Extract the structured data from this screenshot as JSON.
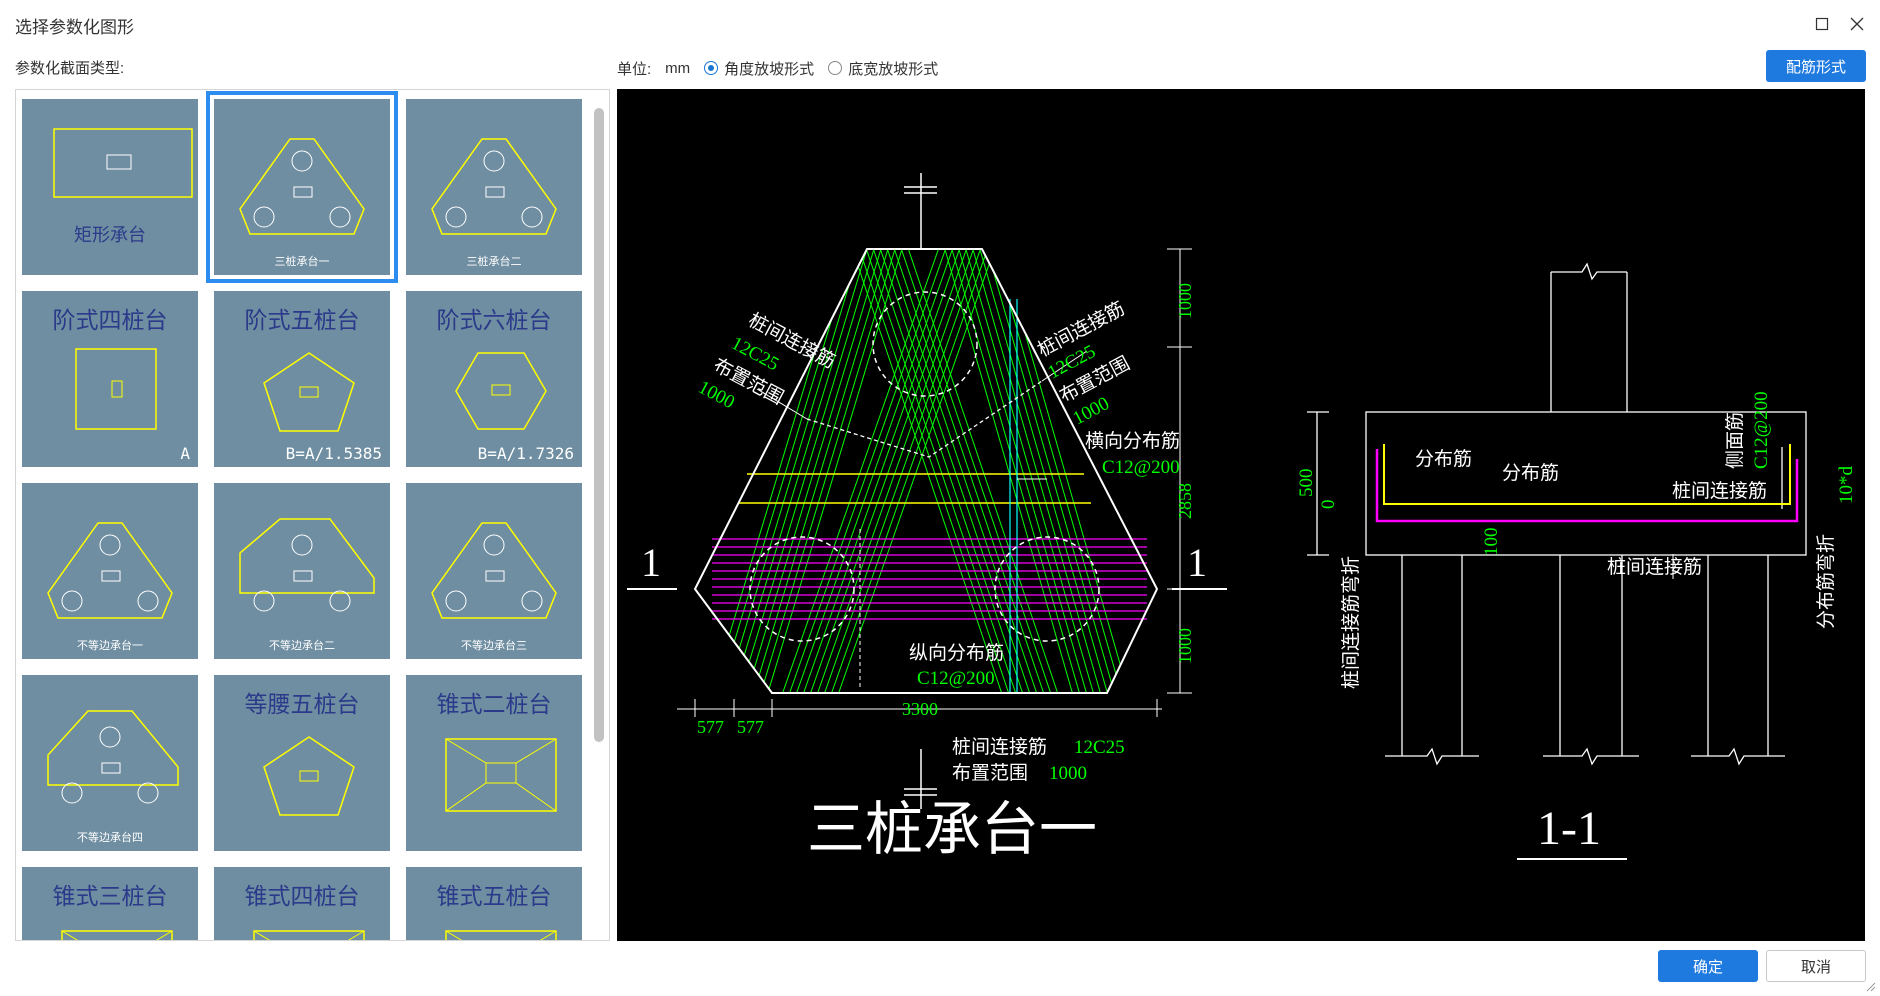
{
  "window": {
    "title": "选择参数化图形"
  },
  "left": {
    "types_label": "参数化截面类型:"
  },
  "top": {
    "unit_label": "单位:",
    "unit_value": "mm",
    "option_angle": "角度放坡形式",
    "option_width": "底宽放坡形式",
    "rebar_button": "配筋形式"
  },
  "footer": {
    "ok": "确定",
    "cancel": "取消"
  },
  "gallery": [
    {
      "name": "矩形承台",
      "style": "bottom"
    },
    {
      "name": "三桩承台一",
      "style": "small",
      "selected": true
    },
    {
      "name": "三桩承台二",
      "style": "small"
    },
    {
      "name": "阶式四桩台",
      "style": "top",
      "note": "A"
    },
    {
      "name": "阶式五桩台",
      "style": "top",
      "note": "B=A/1.5385"
    },
    {
      "name": "阶式六桩台",
      "style": "top",
      "note": "B=A/1.7326"
    },
    {
      "name": "不等边承台一",
      "style": "small"
    },
    {
      "name": "不等边承台二",
      "style": "small"
    },
    {
      "name": "不等边承台三",
      "style": "small"
    },
    {
      "name": "不等边承台四",
      "style": "small"
    },
    {
      "name": "等腰五桩台",
      "style": "top"
    },
    {
      "name": "锥式二桩台",
      "style": "top"
    },
    {
      "name": "锥式三桩台",
      "style": "top"
    },
    {
      "name": "锥式四桩台",
      "style": "top"
    },
    {
      "name": "锥式五桩台",
      "style": "top"
    }
  ],
  "drawing": {
    "plan_title": "三桩承台一",
    "section_title": "1-1",
    "section_mark": "1",
    "labels": {
      "left_conn": "桩间连接筋",
      "left_conn_val": "12C25",
      "left_range": "布置范围",
      "left_range_val": "1000",
      "right_conn": "桩间连接筋",
      "right_conn_val": "12C25",
      "right_range": "布置范围",
      "right_range_val": "1000",
      "trans": "横向分布筋",
      "trans_val": "C12@200",
      "long": "纵向分布筋",
      "long_val": "C12@200",
      "bot_conn": "桩间连接筋",
      "bot_conn_val": "12C25",
      "bot_range": "布置范围",
      "bot_range_val": "1000",
      "dim_577a": "577",
      "dim_577b": "577",
      "dim_3300": "3300",
      "dim_1000a": "1000",
      "dim_2858": "2858",
      "dim_1000b": "1000",
      "sec_dist1": "分布筋",
      "sec_dist2": "分布筋",
      "sec_side": "侧面筋",
      "sec_side_val": "C12@200",
      "sec_conn": "桩间连接筋",
      "sec_conn2": "桩间连接筋",
      "sec_500": "500",
      "sec_0": "0",
      "sec_100": "100",
      "sec_10d": "10*d",
      "sec_bend_left": "桩间连接筋弯折",
      "sec_bend_right": "分布筋弯折"
    }
  },
  "colors": {
    "accent": "#1f7ae0",
    "thumb_bg": "#6f8ea1",
    "green": "#00ff00",
    "yellow": "#ffff00",
    "magenta": "#ff00ff",
    "cyan": "#00ffff"
  }
}
